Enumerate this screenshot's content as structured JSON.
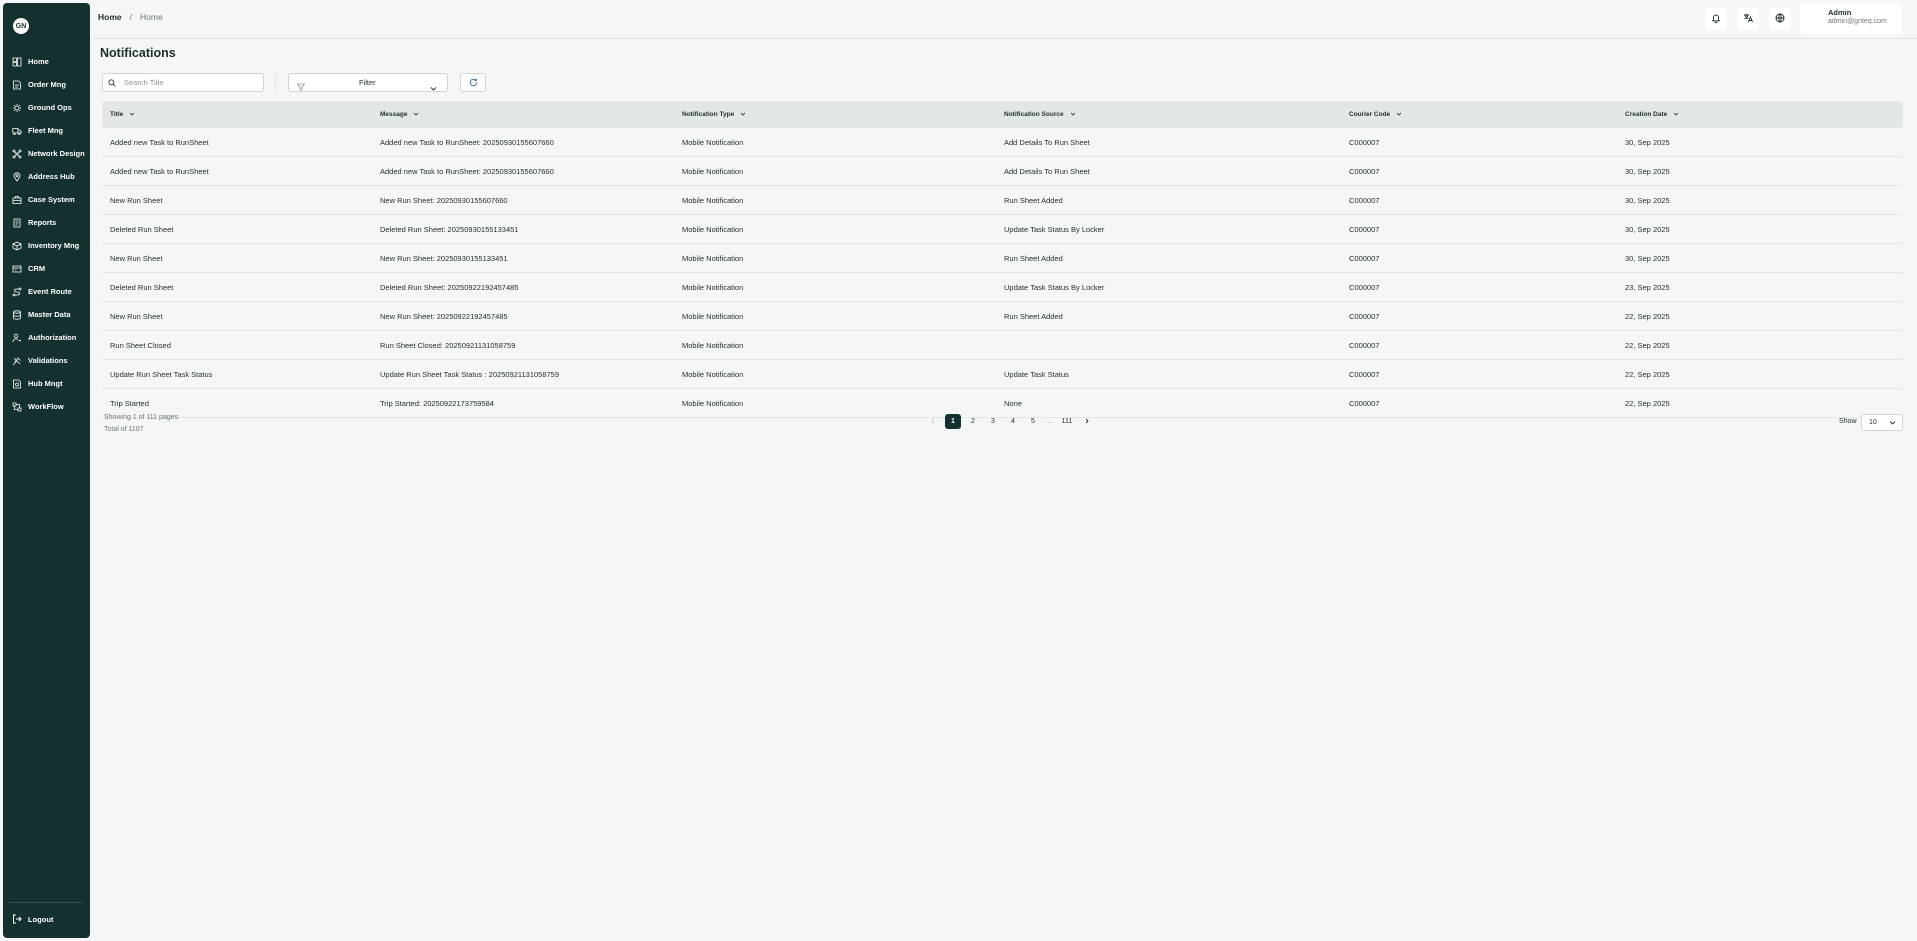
{
  "sidebar": {
    "logo_text": "GN",
    "items": [
      {
        "label": "Home",
        "icon": "home-icon"
      },
      {
        "label": "Order Mng",
        "icon": "order-icon"
      },
      {
        "label": "Ground Ops",
        "icon": "ground-ops-icon"
      },
      {
        "label": "Fleet Mng",
        "icon": "truck-icon"
      },
      {
        "label": "Network Design",
        "icon": "network-icon"
      },
      {
        "label": "Address Hub",
        "icon": "location-icon"
      },
      {
        "label": "Case System",
        "icon": "briefcase-icon"
      },
      {
        "label": "Reports",
        "icon": "report-icon"
      },
      {
        "label": "Inventory Mng",
        "icon": "inventory-icon"
      },
      {
        "label": "CRM",
        "icon": "crm-icon"
      },
      {
        "label": "Event Route",
        "icon": "route-icon"
      },
      {
        "label": "Master Data",
        "icon": "database-icon"
      },
      {
        "label": "Authorization",
        "icon": "user-key-icon"
      },
      {
        "label": "Validations",
        "icon": "validation-icon"
      },
      {
        "label": "Hub Mngt",
        "icon": "hub-icon"
      },
      {
        "label": "WorkFlow",
        "icon": "workflow-icon"
      }
    ],
    "logout_label": "Logout"
  },
  "header": {
    "breadcrumb_root": "Home",
    "breadcrumb_sep": "/",
    "breadcrumb_current": "Home",
    "user_name": "Admin",
    "user_email": "admin@gnteq.com"
  },
  "main": {
    "title": "Notifications",
    "search_placeholder": "Search Title",
    "filter_label": "Filter",
    "columns": [
      "Title",
      "Message",
      "Notification Type",
      "Notification Source",
      "Courier Code",
      "Creation Date"
    ],
    "rows": [
      [
        "Added new Task to RunSheet",
        "Added new Task to RunSheet: 20250930155607660",
        "Mobile Notification",
        "Add Details To Run Sheet",
        "C000007",
        "30, Sep 2025"
      ],
      [
        "Added new Task to RunSheet",
        "Added new Task to RunSheet: 20250930155607660",
        "Mobile Notification",
        "Add Details To Run Sheet",
        "C000007",
        "30, Sep 2025"
      ],
      [
        "New Run Sheet",
        "New Run Sheet: 20250930155607660",
        "Mobile Notification",
        "Run Sheet Added",
        "C000007",
        "30, Sep 2025"
      ],
      [
        "Deleted Run Sheet",
        "Deleted Run Sheet: 20250930155133451",
        "Mobile Notification",
        "Update Task Status By Locker",
        "C000007",
        "30, Sep 2025"
      ],
      [
        "New Run Sheet",
        "New Run Sheet: 20250930155133451",
        "Mobile Notification",
        "Run Sheet Added",
        "C000007",
        "30, Sep 2025"
      ],
      [
        "Deleted Run Sheet",
        "Deleted Run Sheet: 20250922192457485",
        "Mobile Notification",
        "Update Task Status By Locker",
        "C000007",
        "23, Sep 2025"
      ],
      [
        "New Run Sheet",
        "New Run Sheet: 20250922192457485",
        "Mobile Notification",
        "Run Sheet Added",
        "C000007",
        "22, Sep 2025"
      ],
      [
        "Run Sheet Closed",
        "Run Sheet Closed: 20250921131058759",
        "Mobile Notification",
        "",
        "C000007",
        "22, Sep 2025"
      ],
      [
        "Update Run Sheet Task Status",
        "Update Run Sheet Task Status : 20250921131058759",
        "Mobile Notification",
        "Update Task Status",
        "C000007",
        "22, Sep 2025"
      ],
      [
        "Trip Started",
        "Trip Started: 20250922173759584",
        "Mobile Notification",
        "None",
        "C000007",
        "22, Sep 2025"
      ]
    ],
    "showing_text": "Showing 1 of 111 pages",
    "total_text": "Total of 1107",
    "pages": [
      "1",
      "2",
      "3",
      "4",
      "5",
      "...",
      "111"
    ],
    "show_label": "Show",
    "page_size": "10"
  },
  "colors": {
    "sidebar_bg": "#143130",
    "active_page": "#143130",
    "table_header_bg": "#e3e8e7",
    "page_bg": "#f5f7f6"
  }
}
